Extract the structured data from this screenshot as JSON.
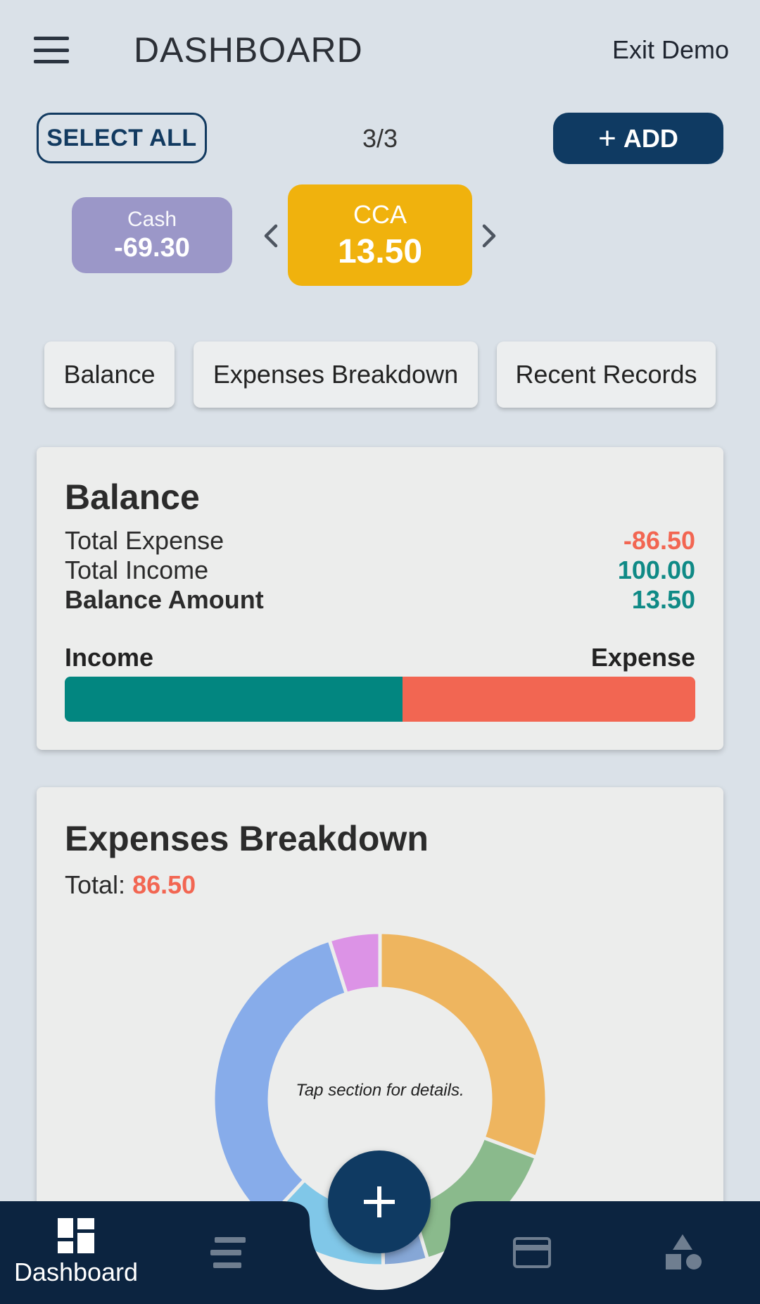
{
  "header": {
    "title": "DASHBOARD",
    "exit_label": "Exit Demo",
    "menu_icon": "hamburger-menu-icon"
  },
  "controls": {
    "select_all_label": "SELECT ALL",
    "count": "3/3",
    "add_label": "ADD",
    "add_icon": "+"
  },
  "accounts": [
    {
      "name": "Cash",
      "value": "-69.30",
      "color": "#9b97c8"
    },
    {
      "name": "CCA",
      "value": "13.50",
      "color": "#f0b20d"
    }
  ],
  "tabs": [
    {
      "label": "Balance"
    },
    {
      "label": "Expenses Breakdown"
    },
    {
      "label": "Recent Records"
    }
  ],
  "balance": {
    "title": "Balance",
    "rows": [
      {
        "label": "Total Expense",
        "value": "-86.50",
        "color": "#f26652"
      },
      {
        "label": "Total Income",
        "value": "100.00",
        "color": "#0f8a86"
      },
      {
        "label": "Balance Amount",
        "value": "13.50",
        "color": "#0f8a86"
      }
    ],
    "bar": {
      "income_label": "Income",
      "expense_label": "Expense",
      "income": 100.0,
      "expense": 86.5,
      "income_color": "#028680",
      "expense_color": "#f26652"
    }
  },
  "expenses": {
    "title": "Expenses Breakdown",
    "total_label": "Total:",
    "total_value": "86.50",
    "center_text": "Tap section for details."
  },
  "chart_data": {
    "type": "pie",
    "title": "",
    "values": [
      25,
      12,
      3.5,
      10,
      27,
      4
    ],
    "colors": [
      "#eeb55f",
      "#8aba8c",
      "#86a7d6",
      "#80c7e8",
      "#87acea",
      "#dc93e6"
    ],
    "legend": "none"
  },
  "colors": {
    "background": "#dae1e8",
    "accent": "#0f3a62",
    "nav_bg": "#0c2440"
  },
  "nav": {
    "items": [
      {
        "label": "Dashboard",
        "icon": "dashboard-icon"
      },
      {
        "label": "",
        "icon": "list-icon"
      },
      {
        "label": "",
        "icon": "card-icon"
      },
      {
        "label": "",
        "icon": "shapes-icon"
      }
    ],
    "fab_icon": "+"
  }
}
